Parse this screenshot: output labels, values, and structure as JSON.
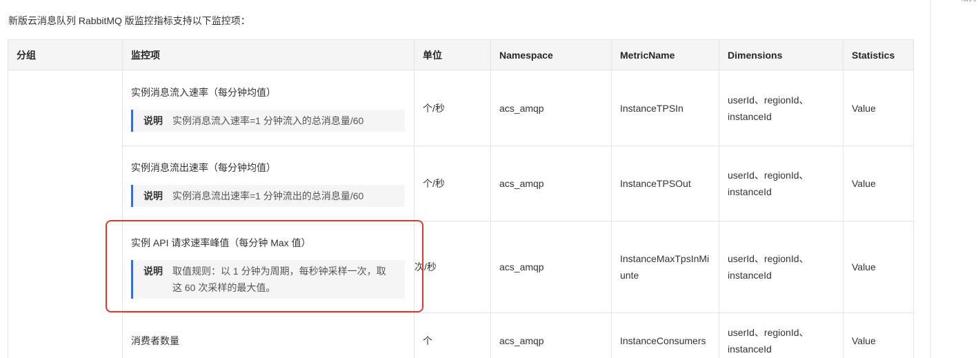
{
  "intro": "新版云消息队列 RabbitMQ 版监控指标支持以下监控项：",
  "rail_text": "相关",
  "columns": [
    "分组",
    "监控项",
    "单位",
    "Namespace",
    "MetricName",
    "Dimensions",
    "Statistics"
  ],
  "rows": [
    {
      "item": "实例消息流入速率（每分钟均值）",
      "note_label": "说明",
      "note": "实例消息流入速率=1 分钟流入的总消息量/60",
      "unit": "个/秒",
      "namespace": "acs_amqp",
      "metric": "InstanceTPSIn",
      "dimensions": "userId、regionId、instanceId",
      "statistics": "Value"
    },
    {
      "item": "实例消息流出速率（每分钟均值）",
      "note_label": "说明",
      "note": "实例消息流出速率=1 分钟流出的总消息量/60",
      "unit": "个/秒",
      "namespace": "acs_amqp",
      "metric": "InstanceTPSOut",
      "dimensions": "userId、regionId、instanceId",
      "statistics": "Value"
    },
    {
      "item": "实例 API 请求速率峰值（每分钟 Max 值）",
      "note_label": "说明",
      "note": "取值规则：以 1 分钟为周期，每秒钟采样一次，取这 60 次采样的最大值。",
      "unit": "次/秒",
      "namespace": "acs_amqp",
      "metric": "InstanceMaxTpsInMiunte",
      "dimensions": "userId、regionId、instanceId",
      "statistics": "Value"
    },
    {
      "item": "消费者数量",
      "unit": "个",
      "namespace": "acs_amqp",
      "metric": "InstanceConsumers",
      "dimensions": "userId、regionId、instanceId",
      "statistics": "Value"
    }
  ]
}
